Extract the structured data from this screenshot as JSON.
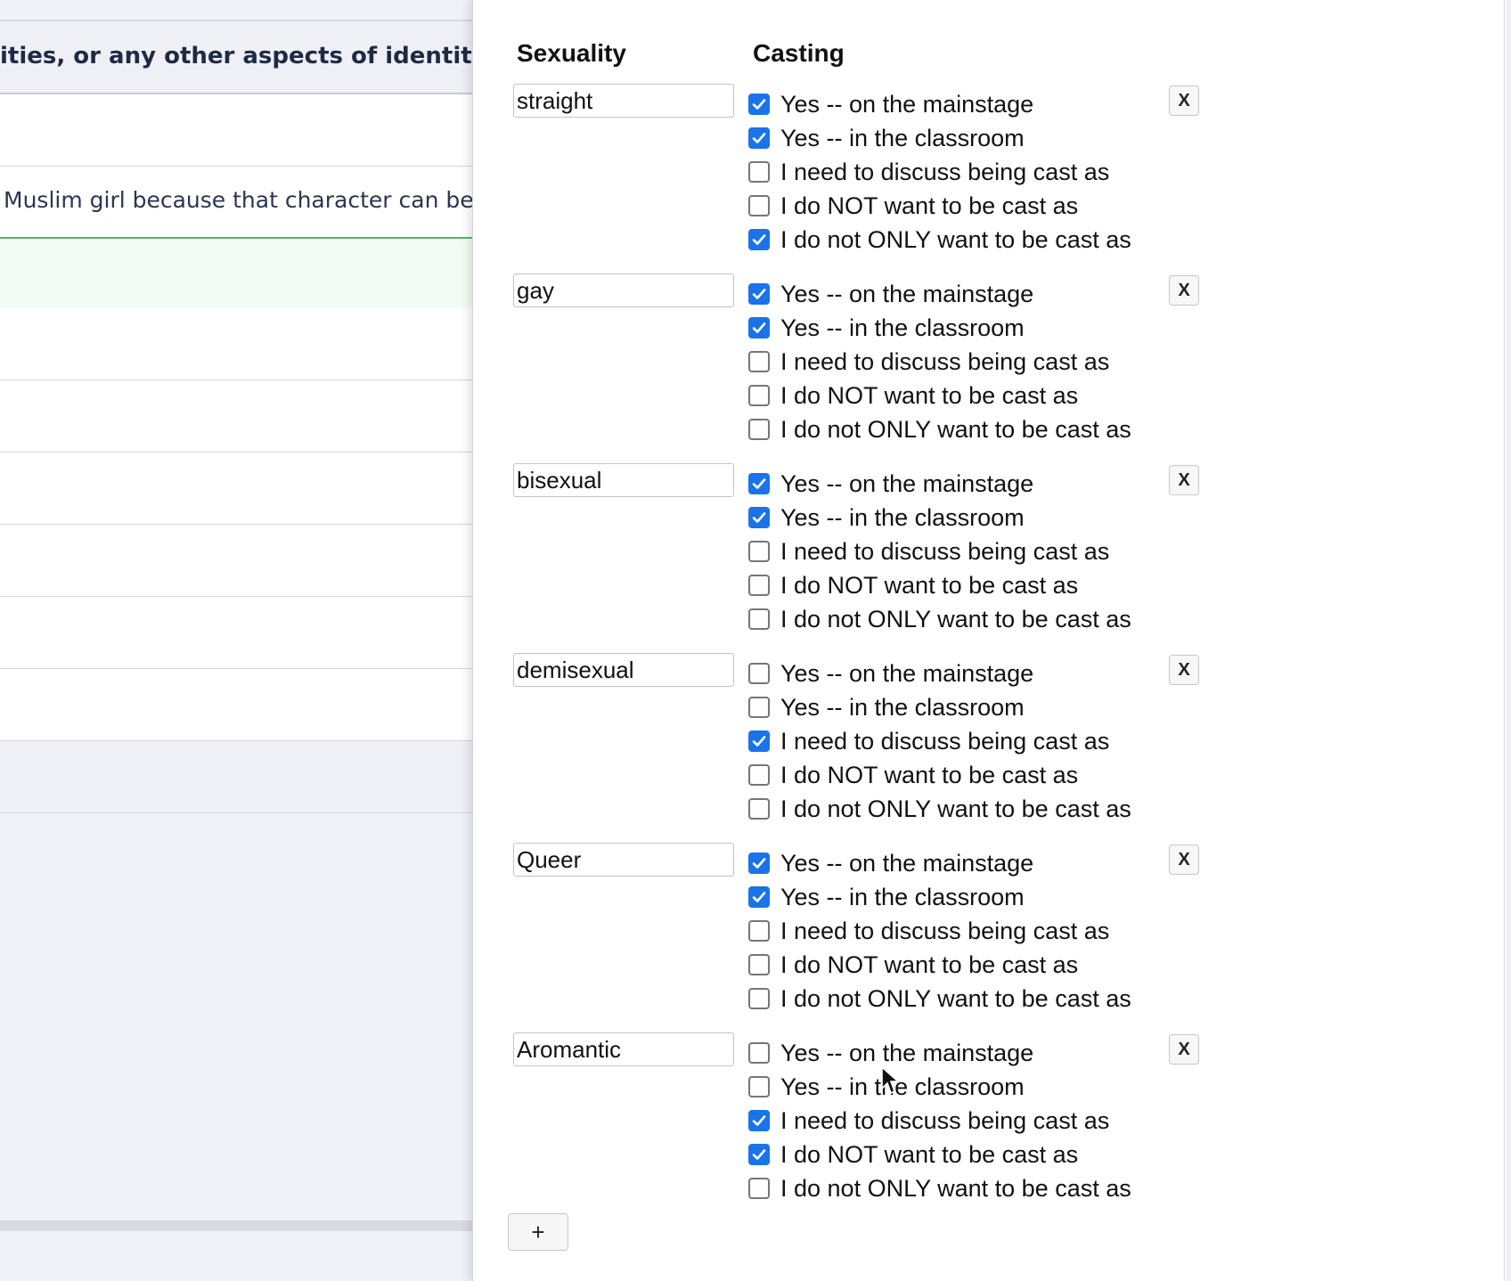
{
  "background": {
    "header_text": "ities, or any other aspects of identity:",
    "row_text": "Muslim girl because that character can be"
  },
  "modal": {
    "column_headers": {
      "sexuality": "Sexuality",
      "casting": "Casting"
    },
    "option_labels": [
      "Yes -- on the mainstage",
      "Yes -- in the classroom",
      "I need to discuss being cast as",
      "I do NOT want to be cast as",
      "I do not ONLY want to be cast as"
    ],
    "entries": [
      {
        "identity": "straight",
        "checked": [
          true,
          true,
          false,
          false,
          true
        ]
      },
      {
        "identity": "gay",
        "checked": [
          true,
          true,
          false,
          false,
          false
        ]
      },
      {
        "identity": "bisexual",
        "checked": [
          true,
          true,
          false,
          false,
          false
        ]
      },
      {
        "identity": "demisexual",
        "checked": [
          false,
          false,
          true,
          false,
          false
        ]
      },
      {
        "identity": "Queer",
        "checked": [
          true,
          true,
          false,
          false,
          false
        ]
      },
      {
        "identity": "Aromantic",
        "checked": [
          false,
          false,
          true,
          true,
          false
        ]
      }
    ],
    "remove_label": "X",
    "add_label": "+"
  },
  "colors": {
    "checkbox_checked": "#1a73e8",
    "accent_green": "#5bb36c"
  }
}
